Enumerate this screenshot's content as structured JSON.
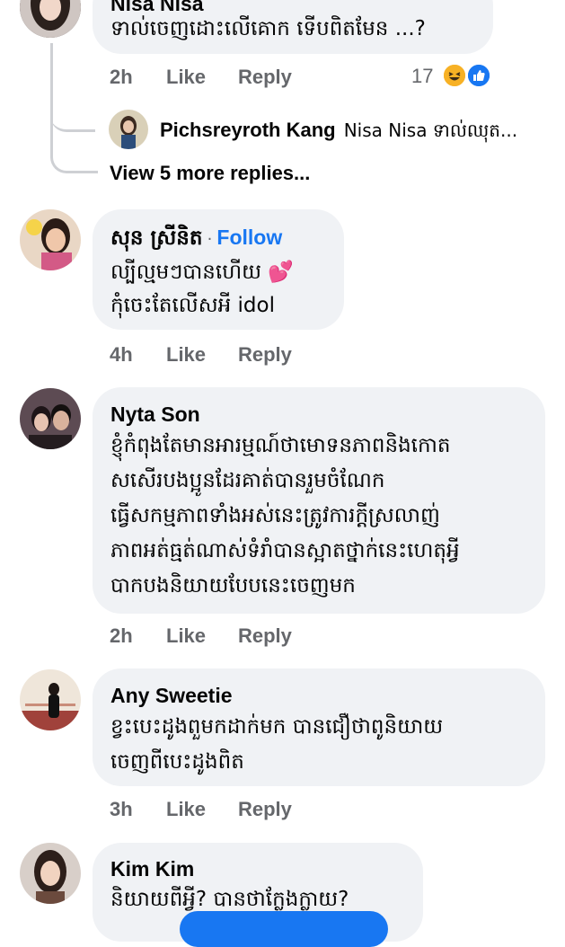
{
  "comments": [
    {
      "author": "Nisa Nisa",
      "lines": [
        "ទាល់ចេញដោះលើគោក ទើបពិតមែន ...?"
      ],
      "time": "2h",
      "like": "Like",
      "reply": "Reply",
      "reaction_count": "17",
      "reaction_icons": [
        "haha-icon",
        "like-icon"
      ],
      "replies_preview": {
        "author": "Pichsreyroth Kang",
        "text": "Nisa Nisa ទាល់ឈុត...",
        "view_more": "View 5 more replies..."
      }
    },
    {
      "author": "សុន ស្រីនិត",
      "follow": "Follow",
      "dot": "·",
      "lines": [
        "ល្បីល្មមៗបានហើយ 💕",
        "កុំចេះតែលើសអី idol"
      ],
      "time": "4h",
      "like": "Like",
      "reply": "Reply"
    },
    {
      "author": "Nyta Son",
      "lines": [
        "ខ្ញុំកំពុងតែមានអារម្មណ៍ថាមោទនភាពនិងកោត",
        "សសើរបងប្អូនដែរគាត់បានរួមចំណែក",
        "ធ្វើសកម្មភាពទាំងអស់នេះត្រូវការក្តីស្រលាញ់",
        "ភាពអត់ធ្មត់ណាស់ទំរាំបានស្អាតថ្នាក់នេះហេតុអ្វី",
        "បាកបងនិយាយបែបនេះចេញមក"
      ],
      "time": "2h",
      "like": "Like",
      "reply": "Reply"
    },
    {
      "author": "Any Sweetie",
      "lines": [
        "ខ្វះបេះដូងពួមកដាក់មក បានជឿថាពូនិយាយ",
        "ចេញពីបេះដូងពិត"
      ],
      "time": "3h",
      "like": "Like",
      "reply": "Reply"
    },
    {
      "author": "Kim Kim",
      "lines": [
        "និយាយពីអ្វី?   បានថាក្លែងក្លាយ?"
      ]
    }
  ],
  "colors": {
    "bubble": "#f0f2f5",
    "meta": "#65676b",
    "accent": "#1877f2",
    "thread": "#ced0d4"
  }
}
